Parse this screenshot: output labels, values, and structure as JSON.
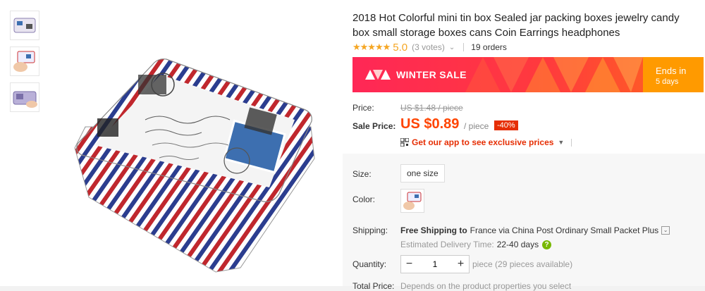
{
  "product": {
    "title": "2018 Hot Colorful mini tin box Sealed jar packing boxes jewelry candy box small storage boxes cans Coin Earrings headphones",
    "rating_stars": "★★★★★",
    "rating_score": "5.0",
    "votes": "(3 votes)",
    "orders": "19 orders"
  },
  "sale": {
    "label": "WINTER SALE",
    "ends_label": "Ends in",
    "ends_value": "5 days"
  },
  "price": {
    "price_label": "Price:",
    "original": "US $1.48 / piece",
    "sale_label": "Sale Price:",
    "sale_value": "US $0.89",
    "per_unit": "/ piece",
    "discount": "-40%"
  },
  "app_promo": {
    "text": "Get our app to see exclusive prices"
  },
  "options": {
    "size_label": "Size:",
    "size_value": "one size",
    "color_label": "Color:"
  },
  "shipping": {
    "label": "Shipping:",
    "free_text": "Free Shipping to",
    "destination": "France via China Post Ordinary Small Packet Plus",
    "est_label": "Estimated Delivery Time:",
    "est_value": "22-40 days"
  },
  "quantity": {
    "label": "Quantity:",
    "value": "1",
    "available": "piece (29 pieces available)"
  },
  "total": {
    "label": "Total Price:",
    "note": "Depends on the product properties you select"
  },
  "colors": {
    "accent": "#ff4400",
    "sale_red": "#ff2756",
    "ends_orange": "#ff9a00",
    "star": "#f5a623"
  }
}
